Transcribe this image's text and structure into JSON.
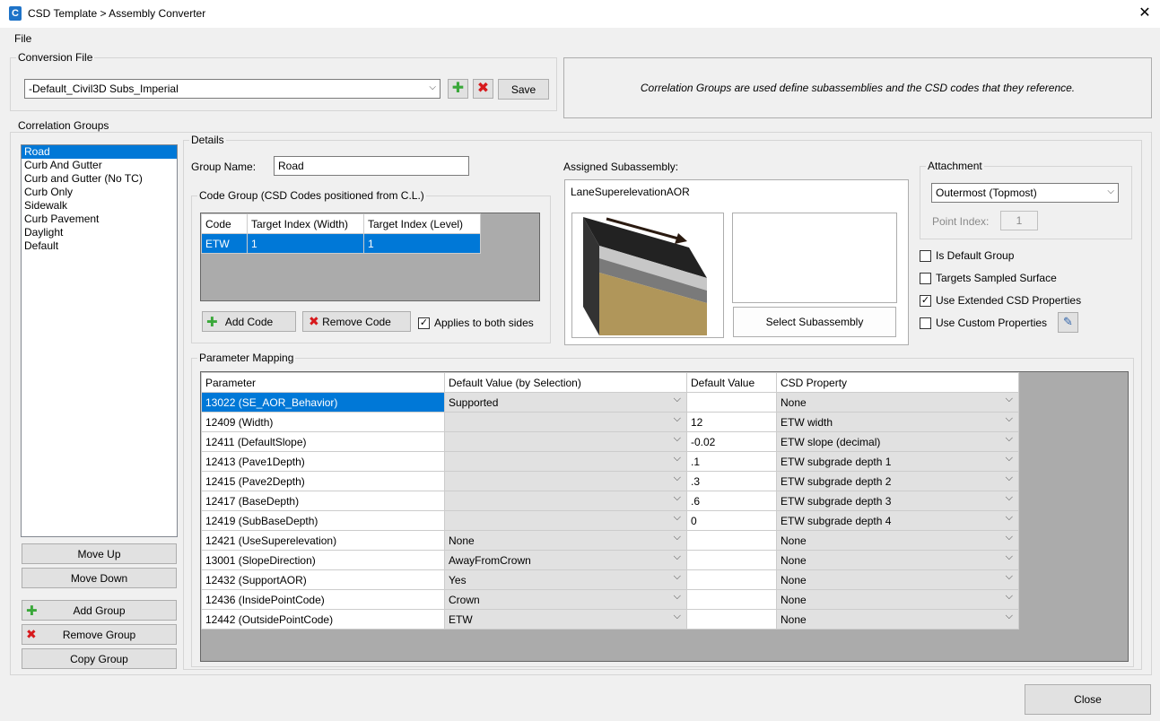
{
  "window": {
    "title": "CSD Template > Assembly Converter",
    "app_icon": "C"
  },
  "menu": {
    "file": "File"
  },
  "conversion_file": {
    "label": "Conversion File",
    "selected": "-Default_Civil3D Subs_Imperial",
    "save": "Save"
  },
  "info_text": "Correlation Groups are used define subassemblies and the CSD codes that they reference.",
  "correlation_groups": {
    "label": "Correlation Groups",
    "items": [
      "Road",
      "Curb And Gutter",
      "Curb and Gutter (No TC)",
      "Curb Only",
      "Sidewalk",
      "Curb Pavement",
      "Daylight",
      "Default"
    ],
    "move_up": "Move Up",
    "move_down": "Move Down",
    "add_group": "Add Group",
    "remove_group": "Remove Group",
    "copy_group": "Copy Group"
  },
  "details": {
    "label": "Details",
    "group_name_label": "Group Name:",
    "group_name": "Road",
    "code_group_label": "Code Group (CSD Codes positioned from C.L.)",
    "code_columns": [
      "Code",
      "Target Index (Width)",
      "Target Index (Level)"
    ],
    "code_rows": [
      [
        "ETW",
        "1",
        "1"
      ]
    ],
    "add_code": "Add Code",
    "remove_code": "Remove Code",
    "applies_both_sides": "Applies to both sides",
    "assigned_label": "Assigned Subassembly:",
    "assigned_name": "LaneSuperelevationAOR",
    "select_subassembly": "Select Subassembly",
    "attachment_label": "Attachment",
    "attachment_value": "Outermost (Topmost)",
    "point_index_label": "Point Index:",
    "point_index": "1",
    "is_default_group": "Is Default Group",
    "targets_sampled": "Targets Sampled Surface",
    "use_extended": "Use Extended CSD Properties",
    "use_custom": "Use Custom Properties"
  },
  "parameter_mapping": {
    "label": "Parameter Mapping",
    "columns": [
      "Parameter",
      "Default Value (by Selection)",
      "Default Value",
      "CSD Property"
    ],
    "rows": [
      [
        "13022 (SE_AOR_Behavior)",
        "Supported",
        "",
        "None"
      ],
      [
        "12409 (Width)",
        "",
        "12",
        "ETW width"
      ],
      [
        "12411 (DefaultSlope)",
        "",
        "-0.02",
        "ETW slope (decimal)"
      ],
      [
        "12413 (Pave1Depth)",
        "",
        ".1",
        "ETW subgrade depth 1"
      ],
      [
        "12415 (Pave2Depth)",
        "",
        ".3",
        "ETW subgrade depth 2"
      ],
      [
        "12417 (BaseDepth)",
        "",
        ".6",
        "ETW subgrade depth 3"
      ],
      [
        "12419 (SubBaseDepth)",
        "",
        "0",
        "ETW subgrade depth 4"
      ],
      [
        "12421 (UseSuperelevation)",
        "None",
        "",
        "None"
      ],
      [
        "13001 (SlopeDirection)",
        "AwayFromCrown",
        "",
        "None"
      ],
      [
        "12432 (SupportAOR)",
        "Yes",
        "",
        "None"
      ],
      [
        "12436 (InsidePointCode)",
        "Crown",
        "",
        "None"
      ],
      [
        "12442 (OutsidePointCode)",
        "ETW",
        "",
        "None"
      ]
    ]
  },
  "close": "Close"
}
